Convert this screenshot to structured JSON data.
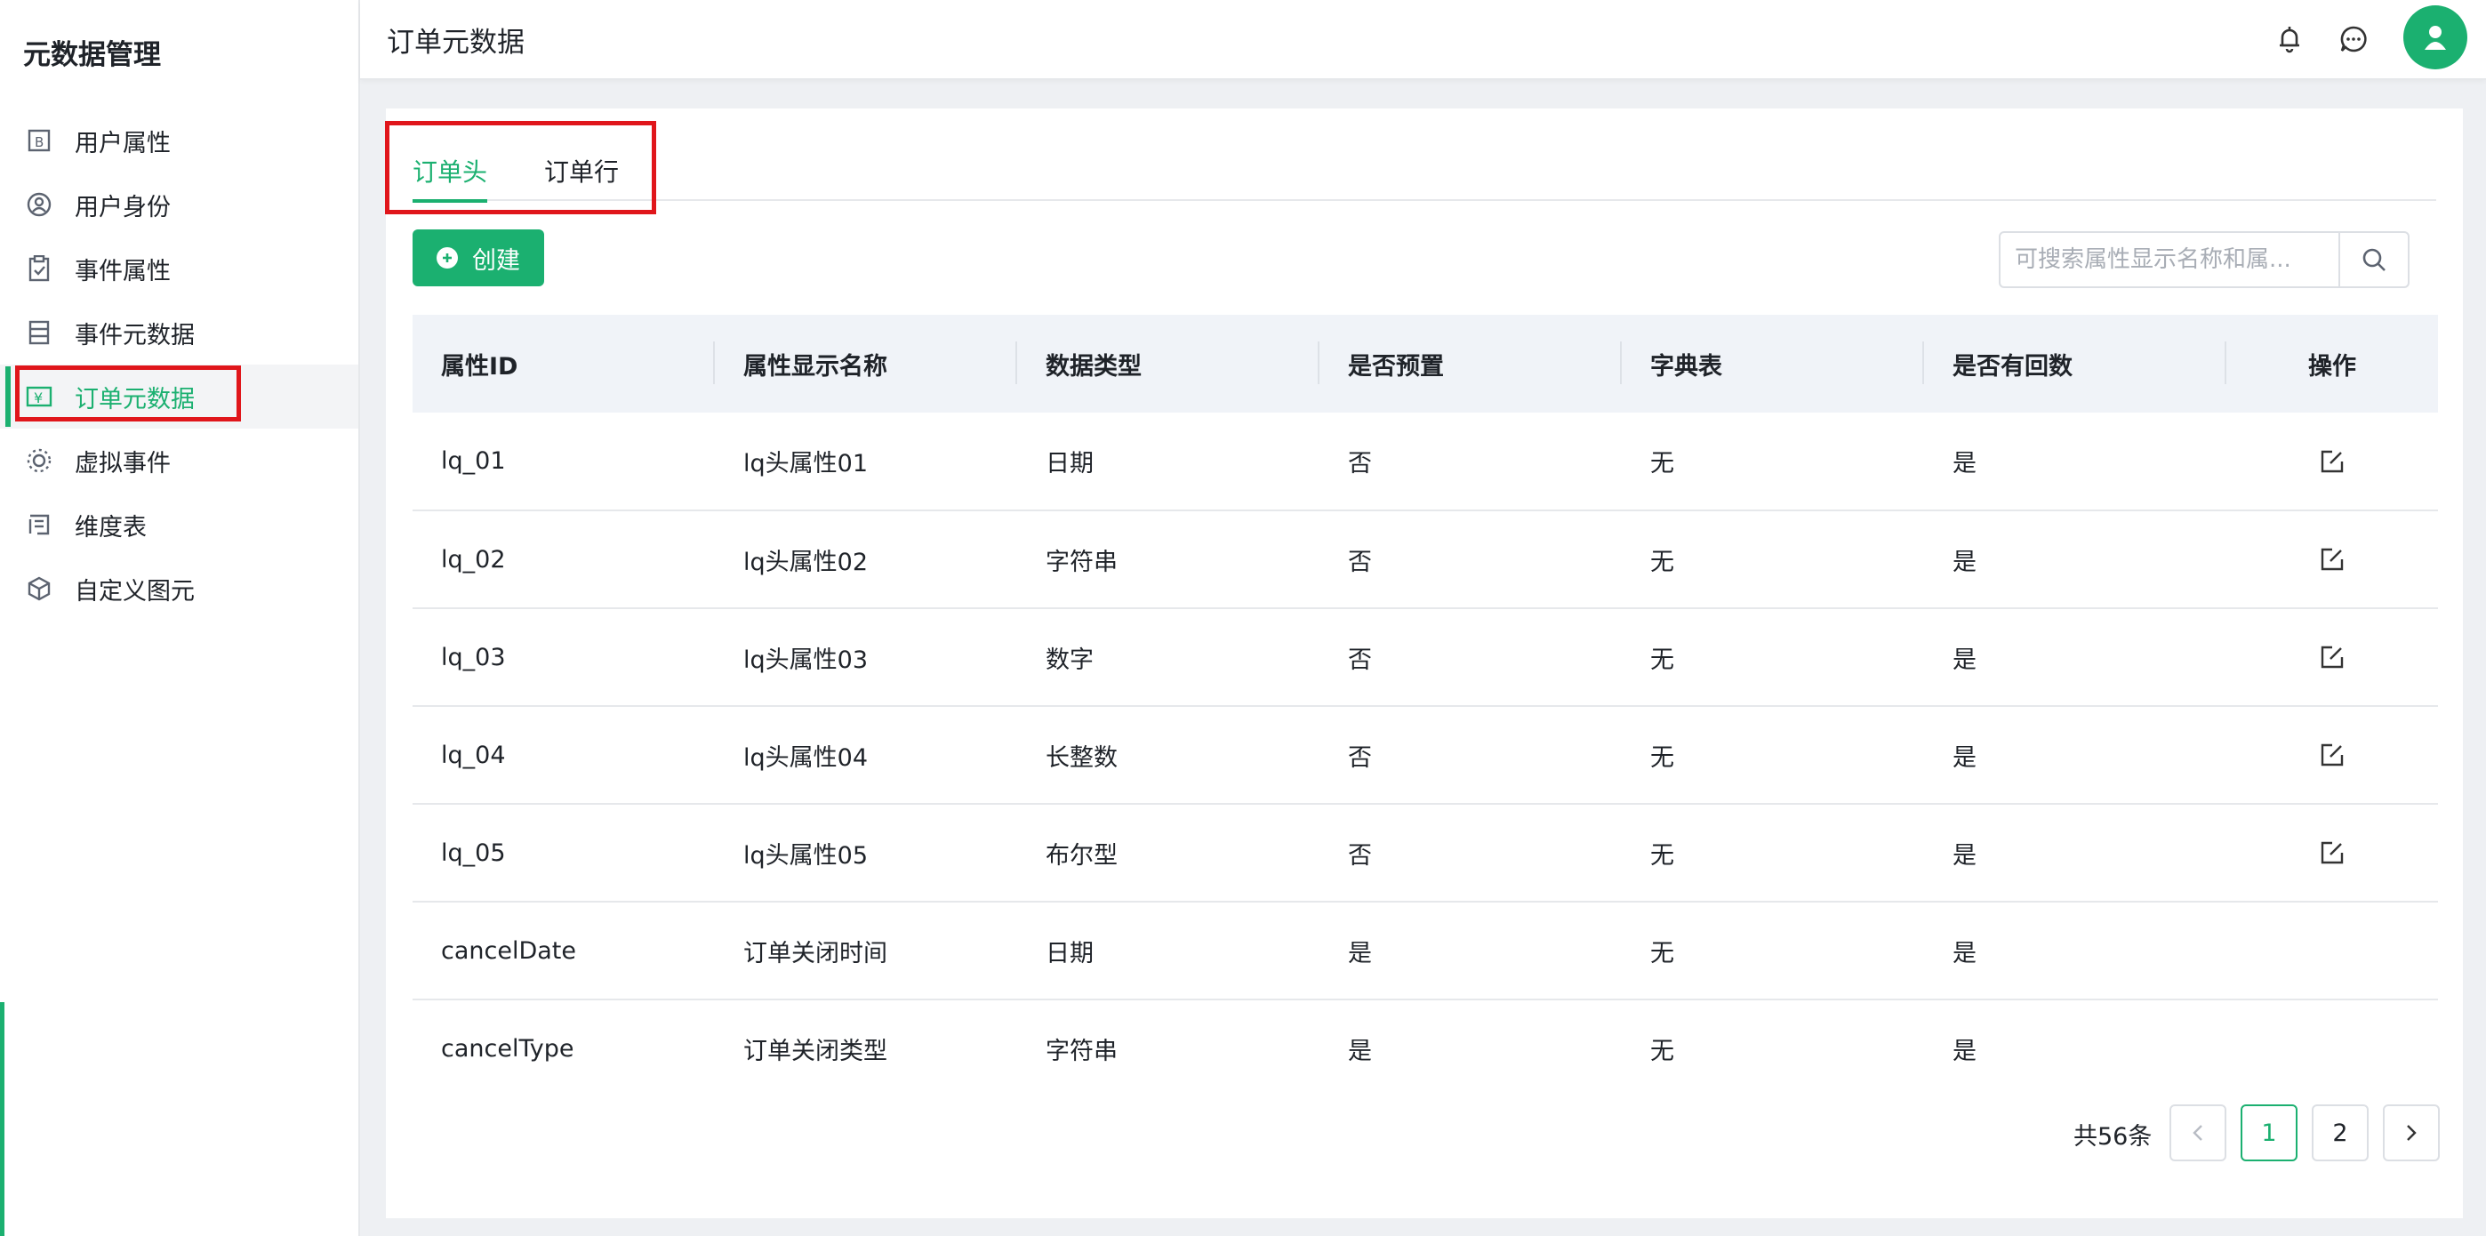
{
  "sidebar": {
    "title": "元数据管理",
    "items": [
      {
        "label": "用户属性",
        "icon": "user-attr-icon"
      },
      {
        "label": "用户身份",
        "icon": "user-identity-icon"
      },
      {
        "label": "事件属性",
        "icon": "event-attr-icon"
      },
      {
        "label": "事件元数据",
        "icon": "event-meta-icon"
      },
      {
        "label": "订单元数据",
        "icon": "order-meta-icon",
        "active": true
      },
      {
        "label": "虚拟事件",
        "icon": "virtual-event-icon"
      },
      {
        "label": "维度表",
        "icon": "dimension-table-icon"
      },
      {
        "label": "自定义图元",
        "icon": "custom-element-icon"
      }
    ]
  },
  "header": {
    "title": "订单元数据"
  },
  "tabs": [
    "订单头",
    "订单行"
  ],
  "toolbar": {
    "create_label": "创建",
    "search_placeholder": "可搜索属性显示名称和属..."
  },
  "table": {
    "columns": [
      "属性ID",
      "属性显示名称",
      "数据类型",
      "是否预置",
      "字典表",
      "是否有回数",
      "操作"
    ],
    "rows": [
      [
        "lq_01",
        "lq头属性01",
        "日期",
        "否",
        "无",
        "是"
      ],
      [
        "lq_02",
        "lq头属性02",
        "字符串",
        "否",
        "无",
        "是"
      ],
      [
        "lq_03",
        "lq头属性03",
        "数字",
        "否",
        "无",
        "是"
      ],
      [
        "lq_04",
        "lq头属性04",
        "长整数",
        "否",
        "无",
        "是"
      ],
      [
        "lq_05",
        "lq头属性05",
        "布尔型",
        "否",
        "无",
        "是"
      ],
      [
        "cancelDate",
        "订单关闭时间",
        "日期",
        "是",
        "无",
        "是"
      ],
      [
        "cancelType",
        "订单关闭类型",
        "字符串",
        "是",
        "无",
        "是"
      ]
    ]
  },
  "pagination": {
    "total": "共56条",
    "pages": [
      "1",
      "2"
    ],
    "current": "1"
  },
  "colors": {
    "accent": "#1bb070",
    "highlight_box": "#e0161b"
  }
}
